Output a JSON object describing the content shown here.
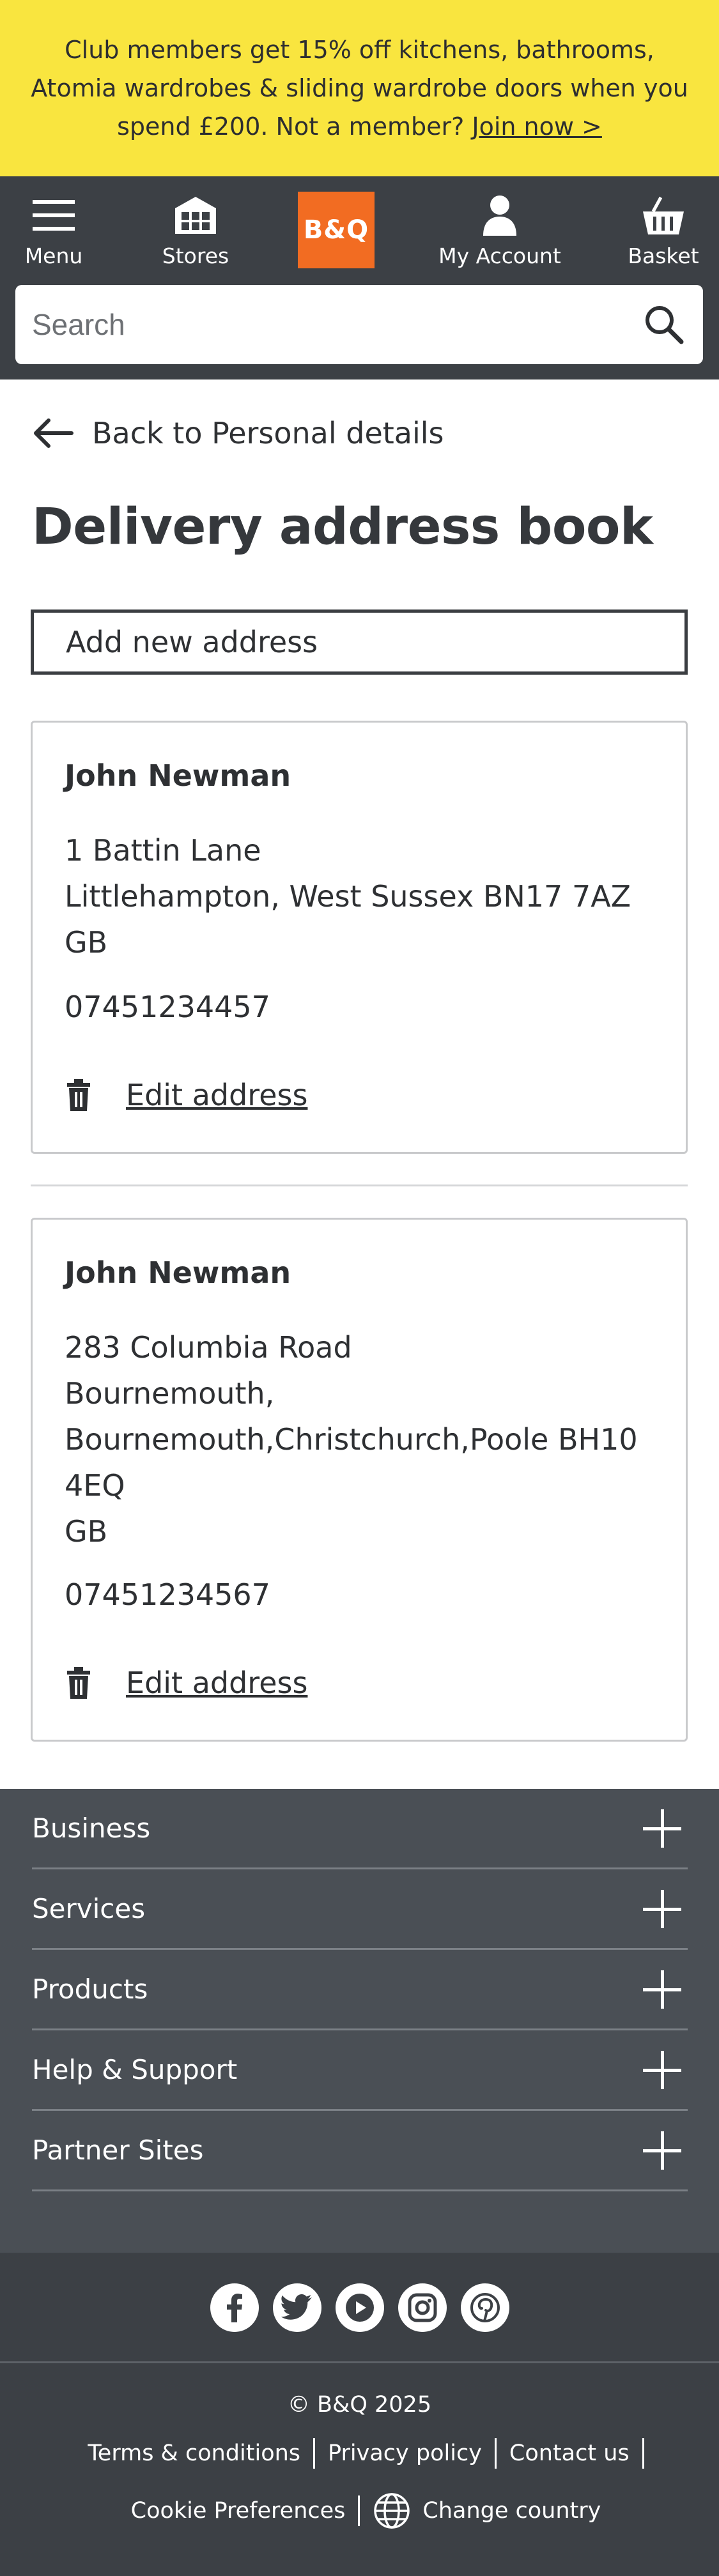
{
  "promo": {
    "text": "Club members get 15% off kitchens, bathrooms, Atomia wardrobes & sliding wardrobe doors when you spend £200. Not a member?",
    "link": "Join now >"
  },
  "header": {
    "menu_label": "Menu",
    "stores_label": "Stores",
    "logo_text": "B&Q",
    "account_label": "My Account",
    "basket_label": "Basket",
    "search_placeholder": "Search"
  },
  "main": {
    "back_label": "Back to Personal details",
    "title": "Delivery address book",
    "add_button": "Add new address",
    "addresses": [
      {
        "name": "John Newman",
        "lines": [
          "1 Battin Lane",
          "Littlehampton, West Sussex BN17 7AZ",
          "GB"
        ],
        "phone": "07451234457",
        "edit_label": "Edit address"
      },
      {
        "name": "John Newman",
        "lines": [
          "283 Columbia Road",
          "Bournemouth,",
          "Bournemouth,Christchurch,Poole BH10",
          "4EQ",
          "GB"
        ],
        "phone": "07451234567",
        "edit_label": "Edit address"
      }
    ]
  },
  "footer": {
    "sections": [
      "Business",
      "Services",
      "Products",
      "Help & Support",
      "Partner Sites"
    ],
    "copyright": "© B&Q 2025",
    "links_row1": [
      "Terms & conditions",
      "Privacy policy",
      "Contact us"
    ],
    "links_row2": [
      "Cookie Preferences",
      "Change country"
    ]
  },
  "colors": {
    "promo_bg": "#f9e53f",
    "header_bg": "#3c4045",
    "brand_orange": "#f26c22",
    "footer_bg": "#4a4f55"
  }
}
